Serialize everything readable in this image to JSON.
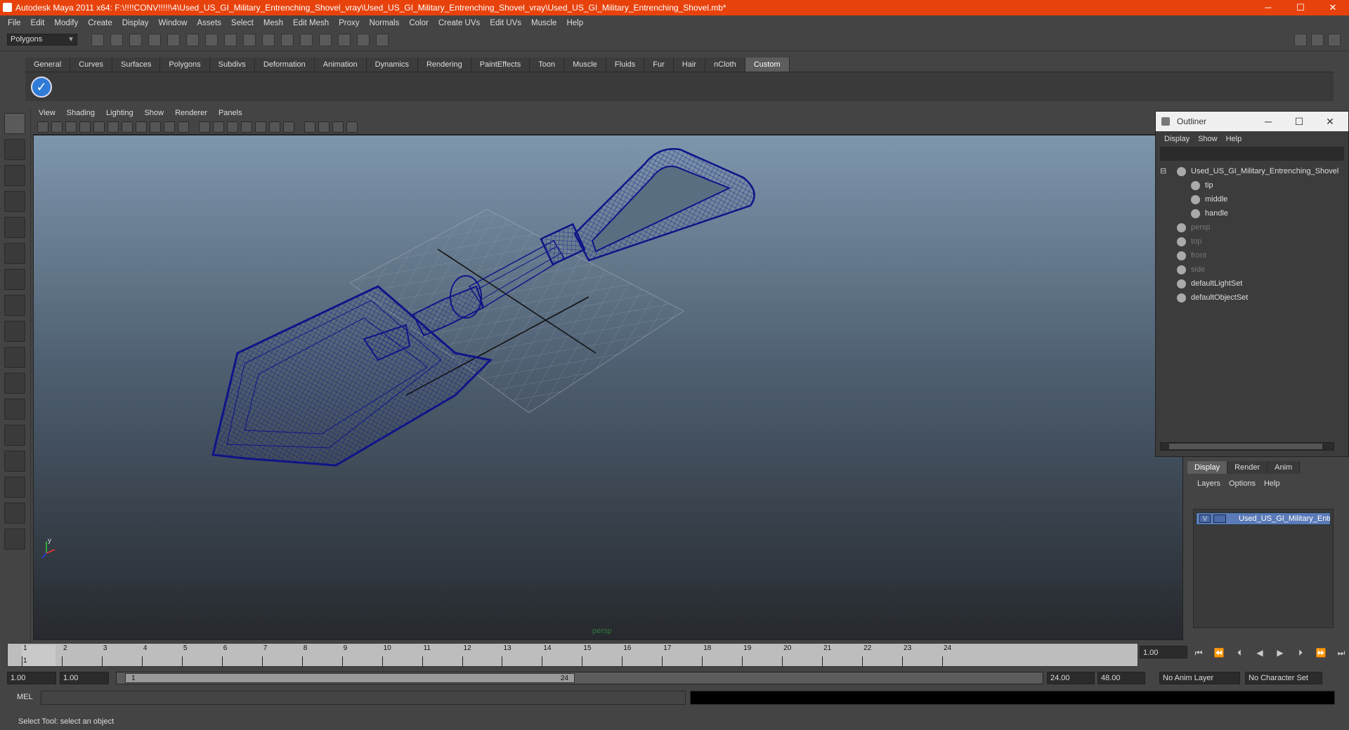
{
  "window": {
    "title": "Autodesk Maya 2011 x64: F:\\!!!!CONV!!!!!\\4\\Used_US_GI_Military_Entrenching_Shovel_vray\\Used_US_GI_Military_Entrenching_Shovel_vray\\Used_US_GI_Military_Entrenching_Shovel.mb*",
    "minimize": "─",
    "maximize": "☐",
    "close": "✕"
  },
  "menubar": [
    "File",
    "Edit",
    "Modify",
    "Create",
    "Display",
    "Window",
    "Assets",
    "Select",
    "Mesh",
    "Edit Mesh",
    "Proxy",
    "Normals",
    "Color",
    "Create UVs",
    "Edit UVs",
    "Muscle",
    "Help"
  ],
  "statusline": {
    "mode": "Polygons",
    "mode_arrow": "▾"
  },
  "shelf": {
    "tabs": [
      "General",
      "Curves",
      "Surfaces",
      "Polygons",
      "Subdivs",
      "Deformation",
      "Animation",
      "Dynamics",
      "Rendering",
      "PaintEffects",
      "Toon",
      "Muscle",
      "Fluids",
      "Fur",
      "Hair",
      "nCloth",
      "Custom"
    ],
    "active_tab": "Custom",
    "button_glyph": "✓"
  },
  "viewport": {
    "menu": [
      "View",
      "Shading",
      "Lighting",
      "Show",
      "Renderer",
      "Panels"
    ],
    "camera_label": "persp",
    "axis_y": "y",
    "wire_color": "#0f1488",
    "grid_color": "#aab3bd"
  },
  "outliner": {
    "title": "Outliner",
    "menu": [
      "Display",
      "Show",
      "Help"
    ],
    "items": [
      {
        "label": "Used_US_GI_Military_Entrenching_Shovel",
        "dim": false
      },
      {
        "label": "tip",
        "dim": false
      },
      {
        "label": "middle",
        "dim": false
      },
      {
        "label": "handle",
        "dim": false
      },
      {
        "label": "persp",
        "dim": true
      },
      {
        "label": "top",
        "dim": true
      },
      {
        "label": "front",
        "dim": true
      },
      {
        "label": "side",
        "dim": true
      },
      {
        "label": "defaultLightSet",
        "dim": false
      },
      {
        "label": "defaultObjectSet",
        "dim": false
      }
    ]
  },
  "layers": {
    "tabs": [
      "Display",
      "Render",
      "Anim"
    ],
    "active_tab": "Display",
    "menu": [
      "Layers",
      "Options",
      "Help"
    ],
    "row": {
      "visible": "V",
      "name": "Used_US_GI_Military_Entrenching_Shovel"
    }
  },
  "timeline": {
    "frames": [
      "1",
      "2",
      "3",
      "4",
      "5",
      "6",
      "7",
      "8",
      "9",
      "10",
      "11",
      "12",
      "13",
      "14",
      "15",
      "16",
      "17",
      "18",
      "19",
      "20",
      "21",
      "22",
      "23",
      "24"
    ],
    "current_frame_label": "1",
    "current_time": "1.00"
  },
  "playback": [
    "⏮",
    "⏪",
    "⏴",
    "◀",
    "▶",
    "⏵",
    "⏩",
    "⏭"
  ],
  "range": {
    "start": "1.00",
    "playback_start": "1.00",
    "slider_start": "1",
    "slider_end": "24",
    "playback_end": "24.00",
    "end": "48.00",
    "anim_layer": "No Anim Layer",
    "character_set": "No Character Set"
  },
  "mel": {
    "label": "MEL"
  },
  "helpline": "Select Tool: select an object"
}
